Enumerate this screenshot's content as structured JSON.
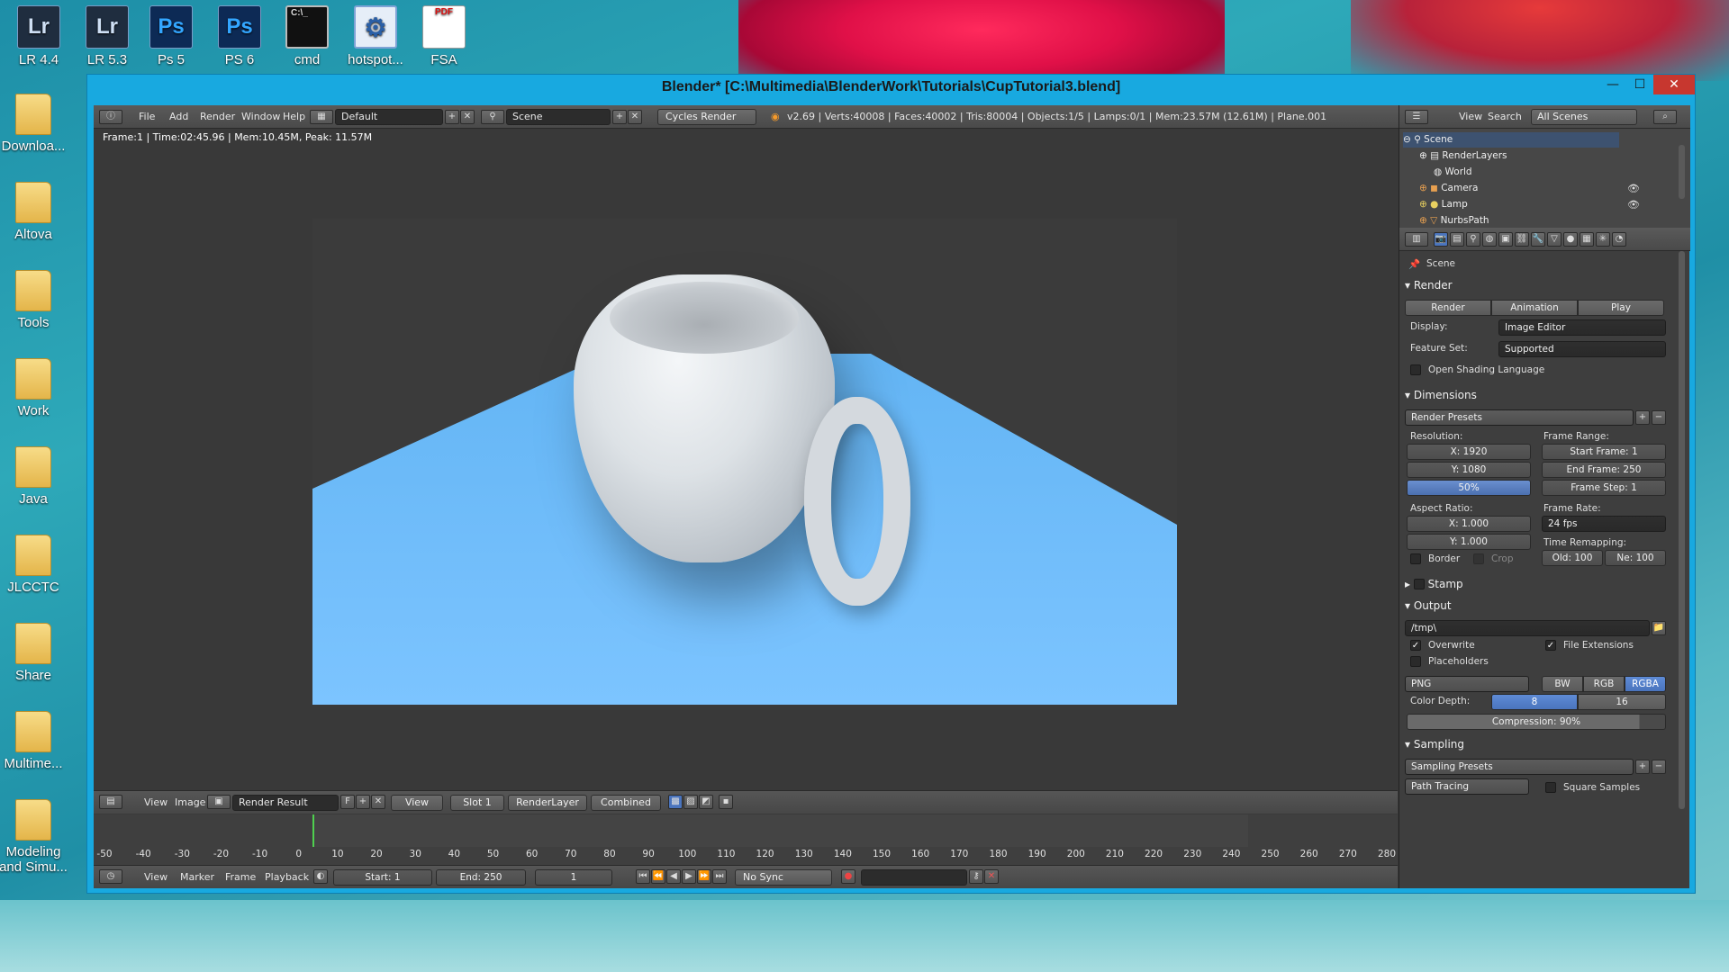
{
  "desktop": {
    "icons": [
      {
        "label": "LR 4.4",
        "glyph": "Lr",
        "kind": "lr"
      },
      {
        "label": "LR 5.3",
        "glyph": "Lr",
        "kind": "lr"
      },
      {
        "label": "Ps 5",
        "glyph": "Ps",
        "kind": "ps"
      },
      {
        "label": "PS 6",
        "glyph": "Ps",
        "kind": "ps"
      },
      {
        "label": "cmd",
        "glyph": "C:\\_",
        "kind": "cmd"
      },
      {
        "label": "hotspot...",
        "glyph": "⚙",
        "kind": "hot"
      },
      {
        "label": "FSA",
        "glyph": "PDF",
        "kind": "pdf"
      }
    ],
    "left_icons": [
      "Downloa...",
      "Altova",
      "Tools",
      "Work",
      "Java",
      "JLCCTC",
      "Share",
      "Multime...",
      "Modeling and Simu..."
    ]
  },
  "window": {
    "title": "Blender* [C:\\Multimedia\\BlenderWork\\Tutorials\\CupTutorial3.blend]",
    "min": "—",
    "max": "☐",
    "close": "✕"
  },
  "info_header": {
    "menu": [
      "File",
      "Add",
      "Render",
      "Window",
      "Help"
    ],
    "layout": "Default",
    "scene": "Scene",
    "engine": "Cycles Render",
    "stats": "v2.69 | Verts:40008 | Faces:40002 | Tris:80004 | Objects:1/5 | Lamps:0/1 | Mem:23.57M (12.61M) | Plane.001"
  },
  "viewport": {
    "info": "Frame:1 | Time:02:45.96 | Mem:10.45M, Peak: 11.57M"
  },
  "image_header": {
    "view": "View",
    "image": "Image",
    "result": "Render Result",
    "f": "F",
    "view2": "View",
    "slot": "Slot 1",
    "layer": "RenderLayer",
    "pass": "Combined"
  },
  "timeline": {
    "ticks": [
      "-50",
      "-40",
      "-30",
      "-20",
      "-10",
      "0",
      "10",
      "20",
      "30",
      "40",
      "50",
      "60",
      "70",
      "80",
      "90",
      "100",
      "110",
      "120",
      "130",
      "140",
      "150",
      "160",
      "170",
      "180",
      "190",
      "200",
      "210",
      "220",
      "230",
      "240",
      "250",
      "260",
      "270",
      "280"
    ],
    "menu": [
      "View",
      "Marker",
      "Frame",
      "Playback"
    ],
    "start": "Start: 1",
    "end": "End: 250",
    "current": "1",
    "sync": "No Sync"
  },
  "outliner": {
    "view": "View",
    "search": "Search",
    "filter": "All Scenes",
    "rows": [
      "Scene",
      "RenderLayers",
      "World",
      "Camera",
      "Lamp",
      "NurbsPath"
    ]
  },
  "properties": {
    "context": "Scene",
    "render": {
      "title": "Render",
      "render_btn": "Render",
      "animation_btn": "Animation",
      "play_btn": "Play",
      "display_label": "Display:",
      "display_value": "Image Editor",
      "feature_label": "Feature Set:",
      "feature_value": "Supported",
      "osl": "Open Shading Language"
    },
    "dimensions": {
      "title": "Dimensions",
      "presets": "Render Presets",
      "resolution": "Resolution:",
      "res_x": "X: 1920",
      "res_y": "Y: 1080",
      "percent": "50%",
      "frame_range": "Frame Range:",
      "start": "Start Frame: 1",
      "end": "End Frame: 250",
      "step": "Frame Step: 1",
      "aspect": "Aspect Ratio:",
      "asp_x": "X: 1.000",
      "asp_y": "Y: 1.000",
      "frame_rate": "Frame Rate:",
      "fps": "24 fps",
      "time_remap": "Time Remapping:",
      "old": "Old: 100",
      "new": "Ne: 100",
      "border": "Border",
      "crop": "Crop"
    },
    "stamp": {
      "title": "Stamp"
    },
    "output": {
      "title": "Output",
      "path": "/tmp\\",
      "overwrite": "Overwrite",
      "file_ext": "File Extensions",
      "placeholders": "Placeholders",
      "format": "PNG",
      "bw": "BW",
      "rgb": "RGB",
      "rgba": "RGBA",
      "depth_label": "Color Depth:",
      "depth8": "8",
      "depth16": "16",
      "compression": "Compression: 90%"
    },
    "sampling": {
      "title": "Sampling",
      "presets": "Sampling Presets",
      "method": "Path Tracing",
      "square": "Square Samples"
    }
  }
}
